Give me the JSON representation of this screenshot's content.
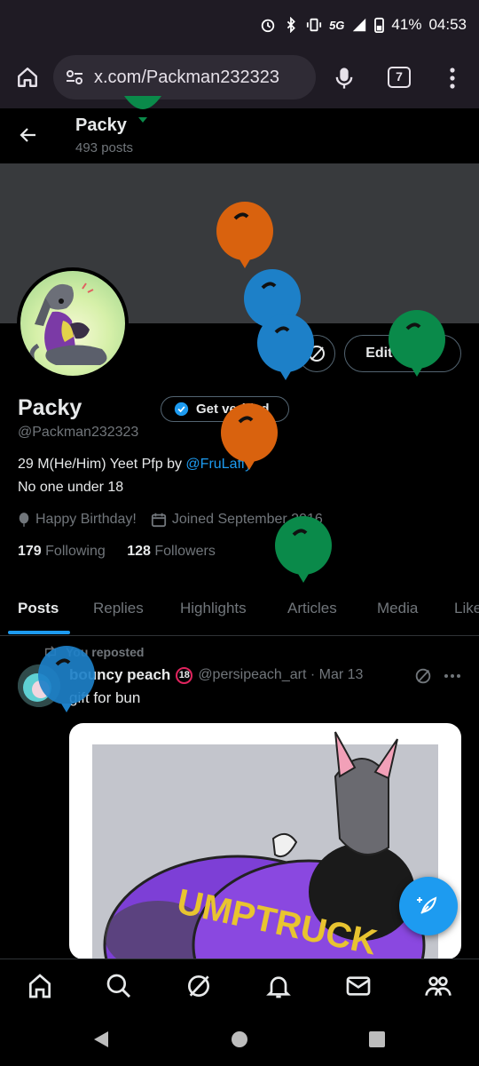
{
  "status_bar": {
    "battery": "41%",
    "time": "04:53",
    "network": "5G"
  },
  "browser": {
    "url": "x.com/Packman232323",
    "tab_count": "7"
  },
  "header": {
    "name": "Packy",
    "post_count": "493 posts"
  },
  "profile": {
    "display_name": "Packy",
    "get_verified_label": "Get verified",
    "handle": "@Packman232323",
    "bio_line1_text": "29 M(He/Him) Yeet Pfp by ",
    "bio_line1_link": "@FruLaffy",
    "bio_line2": "No one under 18",
    "birthday": "Happy Birthday!",
    "joined": "Joined September 2016",
    "following_count": "179",
    "following_label": "Following",
    "followers_count": "128",
    "followers_label": "Followers",
    "edit_profile_label": "Edit profile"
  },
  "tabs": [
    {
      "label": "Posts",
      "active": true
    },
    {
      "label": "Replies"
    },
    {
      "label": "Highlights"
    },
    {
      "label": "Articles"
    },
    {
      "label": "Media"
    },
    {
      "label": "Likes"
    }
  ],
  "post": {
    "repost_label": "You reposted",
    "author_name": "bouncy peach",
    "author_badge": "18",
    "author_handle": "@persipeach_art · Mar 13",
    "text": "gift for bun",
    "image_text": "UMPTRUCK"
  },
  "colors": {
    "accent": "#1d9bf0",
    "balloon_orange": "#d9620e",
    "balloon_blue": "#1d80c8",
    "balloon_green": "#0a8a4a"
  }
}
